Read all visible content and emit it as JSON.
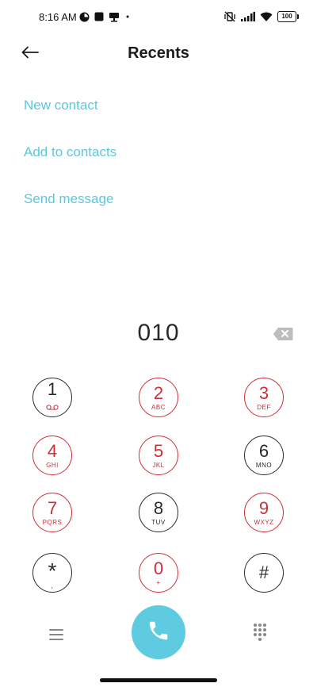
{
  "status_bar": {
    "time": "8:16 AM",
    "battery": "100"
  },
  "header": {
    "title": "Recents"
  },
  "actions": {
    "new_contact": "New contact",
    "add_to_contacts": "Add to contacts",
    "send_message": "Send message"
  },
  "dialer": {
    "number": "010",
    "keys": [
      {
        "digit": "1",
        "sub": ""
      },
      {
        "digit": "2",
        "sub": "ABC"
      },
      {
        "digit": "3",
        "sub": "DEF"
      },
      {
        "digit": "4",
        "sub": "GHI"
      },
      {
        "digit": "5",
        "sub": "JKL"
      },
      {
        "digit": "6",
        "sub": "MNO"
      },
      {
        "digit": "7",
        "sub": "PQRS"
      },
      {
        "digit": "8",
        "sub": "TUV"
      },
      {
        "digit": "9",
        "sub": "WXYZ"
      },
      {
        "digit": "*",
        "sub": ","
      },
      {
        "digit": "0",
        "sub": "+"
      },
      {
        "digit": "#",
        "sub": ""
      }
    ]
  },
  "colors": {
    "accent": "#5cc8dc",
    "key_ring_red": "#cf2e37",
    "key_ring_dark": "#2b2b2b",
    "call": "#5ecbe0"
  }
}
